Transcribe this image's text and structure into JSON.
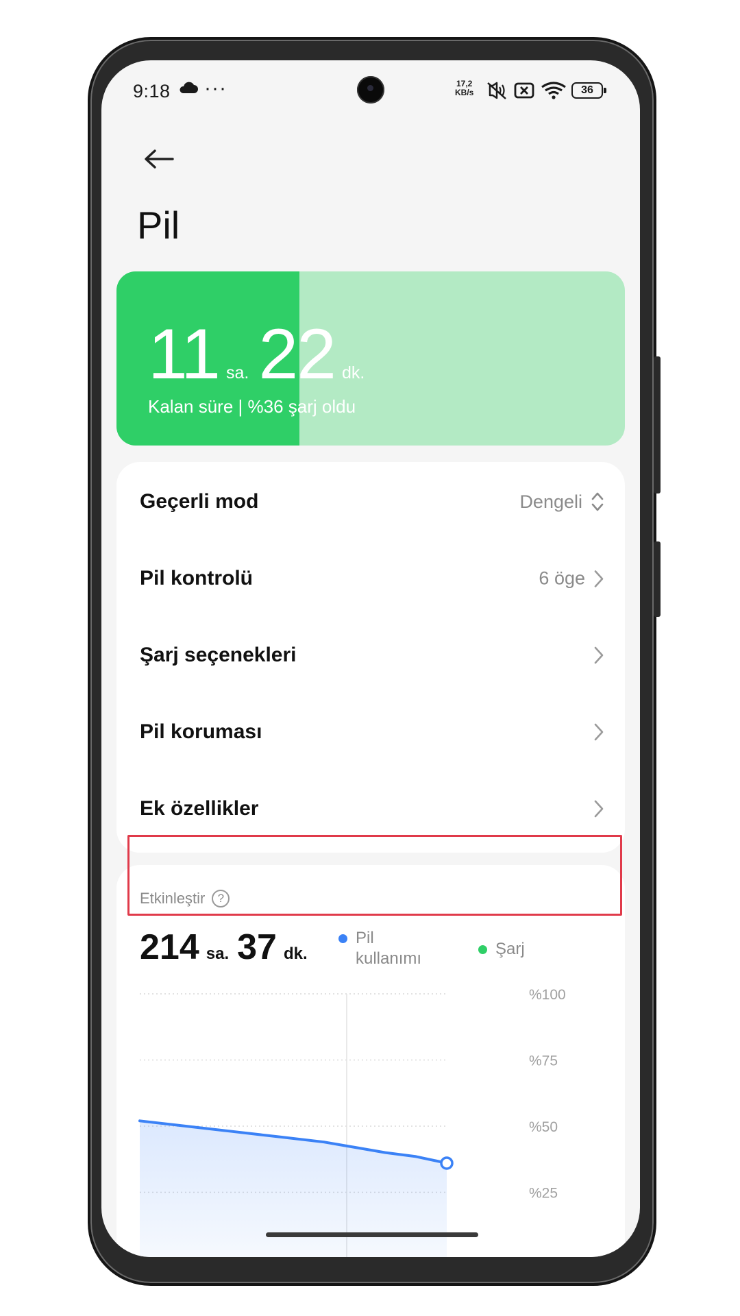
{
  "status_bar": {
    "time": "9:18",
    "more_dots": "···",
    "net_speed_value": "17,2",
    "net_speed_unit": "KB/s",
    "battery_level": "36"
  },
  "header": {
    "title": "Pil"
  },
  "battery_card": {
    "hours": "11",
    "hours_unit": "sa.",
    "minutes": "22",
    "minutes_unit": "dk.",
    "subtitle": "Kalan süre | %36 şarj oldu",
    "charge_fraction": 0.36,
    "fill_color": "#2fcf67",
    "track_color": "#b3eac4"
  },
  "settings": {
    "rows": [
      {
        "label": "Geçerli mod",
        "value": "Dengeli",
        "icon": "chevron-updown-icon"
      },
      {
        "label": "Pil kontrolü",
        "value": "6 öge",
        "icon": "chevron-right-icon"
      },
      {
        "label": "Şarj seçenekleri",
        "value": "",
        "icon": "chevron-right-icon"
      },
      {
        "label": "Pil koruması",
        "value": "",
        "icon": "chevron-right-icon"
      },
      {
        "label": "Ek özellikler",
        "value": "",
        "icon": "chevron-right-icon",
        "highlighted": true
      }
    ],
    "highlight_color": "#e03a4a"
  },
  "usage": {
    "label": "Etkinleştir",
    "hours": "214",
    "hours_unit": "sa.",
    "minutes": "37",
    "minutes_unit": "dk.",
    "legend": [
      {
        "label_line1": "Pil",
        "label_line2": "kullanımı",
        "color": "#3b82f6"
      },
      {
        "label_line1": "Şarj",
        "label_line2": "",
        "color": "#2fcf67"
      }
    ]
  },
  "chart_data": {
    "type": "area",
    "y_tick_labels": [
      "%100",
      "%75",
      "%50",
      "%25"
    ],
    "y_ticks": [
      100,
      75,
      50,
      25
    ],
    "ylim": [
      0,
      100
    ],
    "xlim": [
      0,
      1
    ],
    "grid": true,
    "series": [
      {
        "color": "#3b82f6",
        "x": [
          0,
          0.15,
          0.3,
          0.45,
          0.6,
          0.7,
          0.8,
          0.9,
          1.0
        ],
        "values": [
          52,
          50,
          48,
          46,
          44,
          42,
          40,
          38.5,
          36
        ]
      }
    ]
  }
}
